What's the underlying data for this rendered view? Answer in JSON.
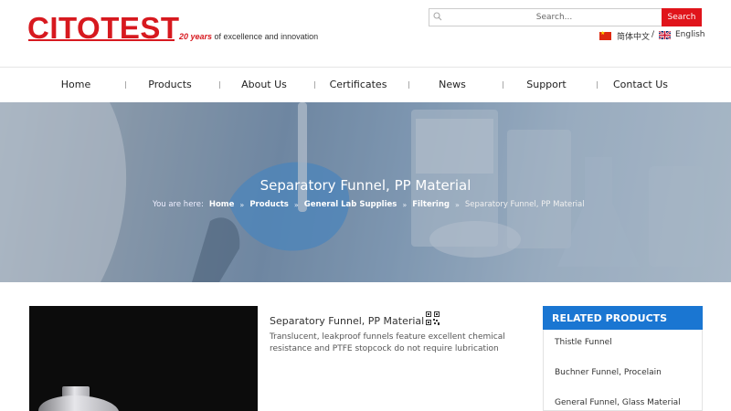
{
  "header": {
    "logo": "CITOTEST",
    "tagline_years": "20 years",
    "tagline_rest": " of excellence and innovation",
    "search_placeholder": "Search...",
    "search_button": "Search",
    "lang_cn": "简体中文",
    "lang_sep": "/",
    "lang_en": "English"
  },
  "nav": {
    "items": [
      "Home",
      "Products",
      "About Us",
      "Certificates",
      "News",
      "Support",
      "Contact Us"
    ]
  },
  "banner": {
    "title": "Separatory Funnel, PP Material",
    "breadcrumb_prefix": "You are here:",
    "breadcrumb": [
      "Home",
      "Products",
      "General Lab Supplies",
      "Filtering"
    ],
    "breadcrumb_current": "Separatory Funnel, PP Material",
    "separator": "»"
  },
  "product": {
    "title": "Separatory Funnel, PP Material",
    "description": "Translucent, leakproof funnels feature excellent chemical resistance and PTFE stopcock do not require lubrication"
  },
  "related": {
    "header": "RELATED PRODUCTS",
    "items": [
      "Thistle Funnel",
      "Buchner Funnel, Procelain",
      "General Funnel, Glass Material"
    ]
  },
  "colors": {
    "brand_red": "#d7191f",
    "related_blue": "#1a76d2"
  }
}
